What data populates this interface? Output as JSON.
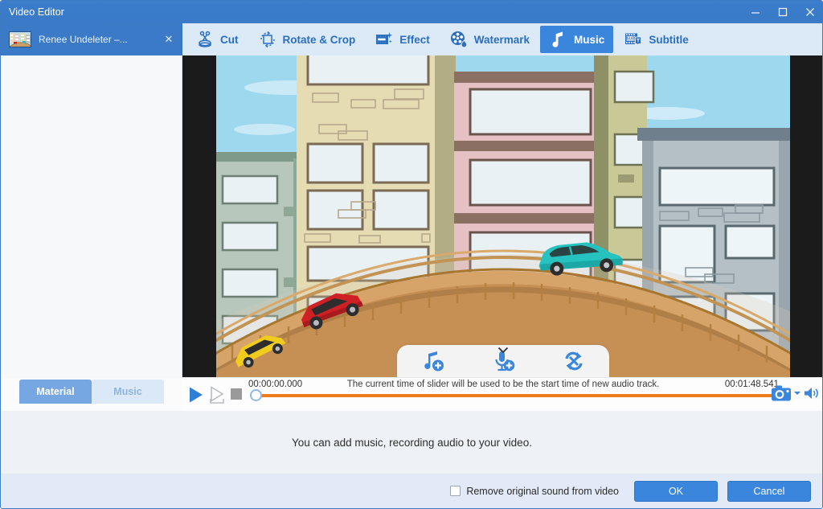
{
  "window": {
    "title": "Video Editor",
    "controls": [
      {
        "name": "minimize-button",
        "glyph": "minimize"
      },
      {
        "name": "maximize-button",
        "glyph": "maximize"
      },
      {
        "name": "close-button",
        "glyph": "close"
      }
    ]
  },
  "document_tab": {
    "label": "Renee Undeleter –...",
    "close_label": "✕"
  },
  "toolbar": {
    "items": [
      {
        "label": "Cut",
        "icon": "scissors-icon",
        "active": false
      },
      {
        "label": "Rotate & Crop",
        "icon": "rotate-crop-icon",
        "active": false
      },
      {
        "label": "Effect",
        "icon": "film-sparkle-icon",
        "active": false
      },
      {
        "label": "Watermark",
        "icon": "watermark-droplet-icon",
        "active": false
      },
      {
        "label": "Music",
        "icon": "music-note-icon",
        "active": true
      },
      {
        "label": "Subtitle",
        "icon": "subtitle-icon",
        "active": false
      }
    ],
    "active_color": "#3b86dd",
    "text_color": "#2a6fc0",
    "bar_color": "#dce9f7"
  },
  "left_panel": {
    "tabs": [
      {
        "label": "Material",
        "selected": true
      },
      {
        "label": "Music",
        "selected": false
      }
    ],
    "empty": true
  },
  "music_popup": {
    "actions": [
      {
        "name": "add-music-button",
        "icon": "add-music-note-icon"
      },
      {
        "name": "add-recording-button",
        "icon": "add-microphone-icon"
      },
      {
        "name": "loop-audio-button",
        "icon": "loop-refresh-icon"
      }
    ],
    "collapse_icon": "chevron-down-icon"
  },
  "transport": {
    "play_label": "Play",
    "play_selection_label": "Play selection",
    "stop_label": "Stop",
    "start_time": "00:00:00.000",
    "end_time": "00:01:48.541",
    "hint": "The current time of slider will be used to be the start time of new audio track.",
    "progress_percent": 0,
    "track_color": "#ef7c1a",
    "snapshot_icon": "camera-snapshot-icon",
    "snapshot_dropdown_icon": "chevron-down-icon",
    "volume_icon": "speaker-volume-icon"
  },
  "message_panel": {
    "text": "You can add music, recording audio to your video."
  },
  "footer": {
    "checkbox": {
      "label": "Remove original sound from video",
      "checked": false
    },
    "buttons": [
      {
        "label": "OK",
        "name": "ok-button"
      },
      {
        "label": "Cancel",
        "name": "cancel-button"
      }
    ],
    "button_color": "#3b86dd"
  },
  "preview": {
    "description": "Cartoon city scene: arched brown bridge over a street with buildings, three cars driving up the bridge",
    "cars": [
      {
        "color": "#f2cc1d",
        "name": "yellow-car"
      },
      {
        "color": "#cf2026",
        "name": "red-car"
      },
      {
        "color": "#25c2c0",
        "name": "teal-car"
      }
    ],
    "bridge_color": "#cf9a5d",
    "sky_color": "#9ed8ef",
    "letterbox_color": "#1b1b1b"
  }
}
